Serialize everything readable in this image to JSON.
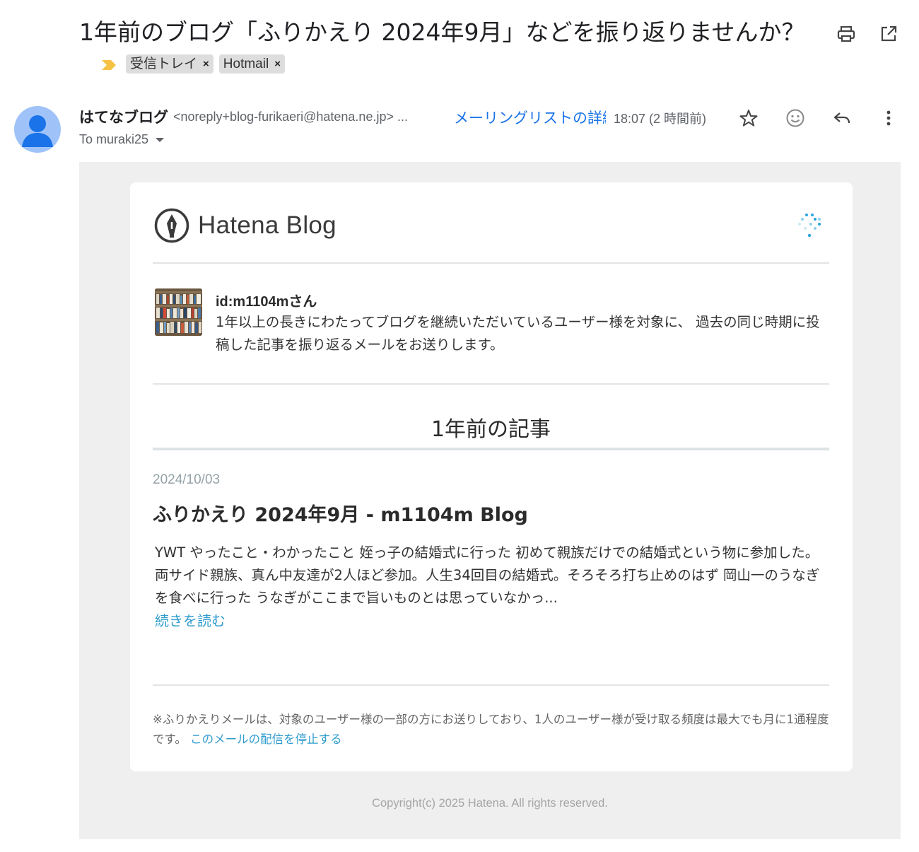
{
  "subject": {
    "text": "1年前のブログ「ふりかえり 2024年9月」などを振り返りませんか？",
    "importance_icon": "importance-marker-icon",
    "labels": [
      {
        "name": "受信トレイ",
        "remove": "×"
      },
      {
        "name": "Hotmail",
        "remove": "×"
      }
    ]
  },
  "header_actions": {
    "print": "print-icon",
    "popout": "open-in-new-window-icon"
  },
  "sender": {
    "name": "はてなブログ",
    "email": "<noreply+blog-furikaeri@hatena.ne.jp> ...",
    "mailing_list": "メーリングリストの詳細",
    "timestamp": "18:07 (2 時間前)",
    "to": "To muraki25"
  },
  "message_actions": [
    "star-icon",
    "emoji-reaction-icon",
    "reply-icon",
    "more-options-icon"
  ],
  "email": {
    "brand": "Hatena Blog",
    "greeting": {
      "name": "id:m1104mさん",
      "message": "1年以上の長きにわたってブログを継続いただいているユーザー様を対象に、 過去の同じ時期に投稿した記事を振り返るメールをお送りします。"
    },
    "section_title": "1年前の記事",
    "post": {
      "date": "2024/10/03",
      "title": "ふりかえり 2024年9月 - m1104m Blog",
      "excerpt": "YWT やったこと・わかったこと 姪っ子の結婚式に行った 初めて親族だけでの結婚式という物に参加した。両サイド親族、真ん中友達が2人ほど参加。人生34回目の結婚式。そろそろ打ち止めのはず 岡山一のうなぎを食べに行った うなぎがここまで旨いものとは思っていなかっ...",
      "read_more": "続きを読む"
    },
    "footer_note": "※ふりかえりメールは、対象のユーザー様の一部の方にお送りしており、1人のユーザー様が受け取る頻度は最大でも月に1通程度です。",
    "unsubscribe": "このメールの配信を停止する",
    "copyright": "Copyright(c) 2025 Hatena. All rights reserved."
  },
  "colors": {
    "link_blue": "#1a73e8",
    "hatena_link": "#2f9ccd",
    "importance_yellow": "#f6c244",
    "avatar_blue": "#1a73e8",
    "body_bg": "#efefef"
  }
}
